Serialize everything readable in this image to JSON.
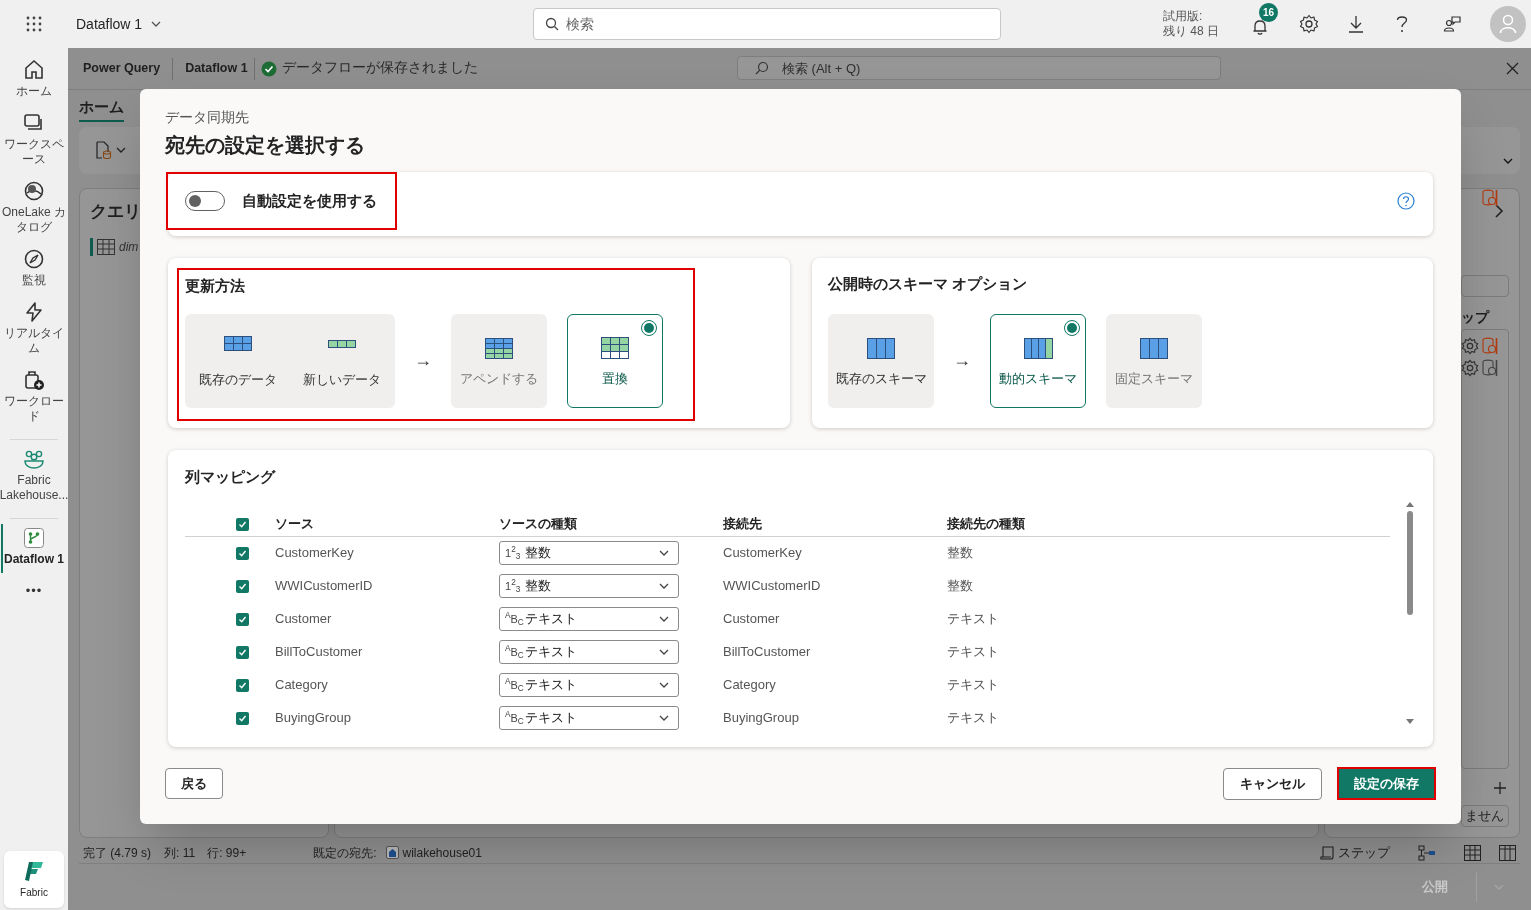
{
  "top_bar": {
    "app_title": "Dataflow 1",
    "search": {
      "placeholder": "検索"
    },
    "trial": [
      "試用版:",
      "残り 48 日"
    ],
    "notifications": "16"
  },
  "nav": {
    "groups": [
      [
        {
          "label": "ホーム",
          "selected": false
        },
        {
          "label": "ワークスペース",
          "selected": false
        },
        {
          "label": "OneLake カタログ",
          "selected": false
        },
        {
          "label": "監視",
          "selected": false
        },
        {
          "label": "リアルタイム",
          "selected": false
        },
        {
          "label": "ワークロード",
          "selected": false
        }
      ],
      [
        {
          "label": "Fabric Lakehouse...",
          "selected": false
        }
      ],
      [
        {
          "label": "Dataflow 1",
          "selected": true
        }
      ]
    ],
    "more": "•••",
    "bottom": "Fabric"
  },
  "editor": {
    "breadcrumbs": [
      "Power Query",
      "Dataflow 1"
    ],
    "save_status": "データフローが保存されました",
    "search": {
      "placeholder": "検索 (Alt + Q)"
    },
    "ribbon_tab": "ホーム",
    "queries_title": "クエリ",
    "query_item": "dim",
    "steps_fragment": "ップ",
    "button_fragment": "ません",
    "status": {
      "left": [
        "完了 (4.79 s)",
        "列: 11",
        "行: 99+"
      ],
      "destination_label": "既定の宛先:",
      "destination": "wilakehouse01",
      "steps": "ステップ"
    },
    "publish": "公開"
  },
  "dialog": {
    "subtitle": "データ同期先",
    "title": "宛先の設定を選択する",
    "auto_settings": {
      "label": "自動設定を使用する",
      "on": false,
      "highlighted": true
    },
    "update_method": {
      "title": "更新方法",
      "highlighted": true,
      "arrow": "→",
      "source": [
        {
          "label": "既存のデータ"
        },
        {
          "label": "新しいデータ"
        }
      ],
      "options": [
        {
          "label": "アペンドする",
          "selected": false
        },
        {
          "label": "置換",
          "selected": true
        }
      ]
    },
    "schema": {
      "title": "公開時のスキーマ オプション",
      "arrow": "→",
      "source": {
        "label": "既存のスキーマ"
      },
      "options": [
        {
          "label": "動的スキーマ",
          "selected": true
        },
        {
          "label": "固定スキーマ",
          "selected": false
        }
      ]
    },
    "mapping": {
      "title": "列マッピング",
      "all_checked": true,
      "columns": [
        "ソース",
        "ソースの種類",
        "接続先",
        "接続先の種類"
      ],
      "rows": [
        {
          "checked": true,
          "source": "CustomerKey",
          "type_icon": "1$^{2}$$_{3}$",
          "source_type": "整数",
          "destination": "CustomerKey",
          "destination_type": "整数"
        },
        {
          "checked": true,
          "source": "WWICustomerID",
          "type_icon": "1$^{2}$$_{3}$",
          "source_type": "整数",
          "destination": "WWICustomerID",
          "destination_type": "整数"
        },
        {
          "checked": true,
          "source": "Customer",
          "type_icon": "$^{A}$B$_{C}$",
          "source_type": "テキスト",
          "destination": "Customer",
          "destination_type": "テキスト"
        },
        {
          "checked": true,
          "source": "BillToCustomer",
          "type_icon": "$^{A}$B$_{C}$",
          "source_type": "テキスト",
          "destination": "BillToCustomer",
          "destination_type": "テキスト"
        },
        {
          "checked": true,
          "source": "Category",
          "type_icon": "$^{A}$B$_{C}$",
          "source_type": "テキスト",
          "destination": "Category",
          "destination_type": "テキスト"
        },
        {
          "checked": true,
          "source": "BuyingGroup",
          "type_icon": "$^{A}$B$_{C}$",
          "source_type": "テキスト",
          "destination": "BuyingGroup",
          "destination_type": "テキスト"
        }
      ]
    },
    "buttons": {
      "back": "戻る",
      "cancel": "キャンセル",
      "save": "設定の保存",
      "save_highlighted": true
    }
  }
}
